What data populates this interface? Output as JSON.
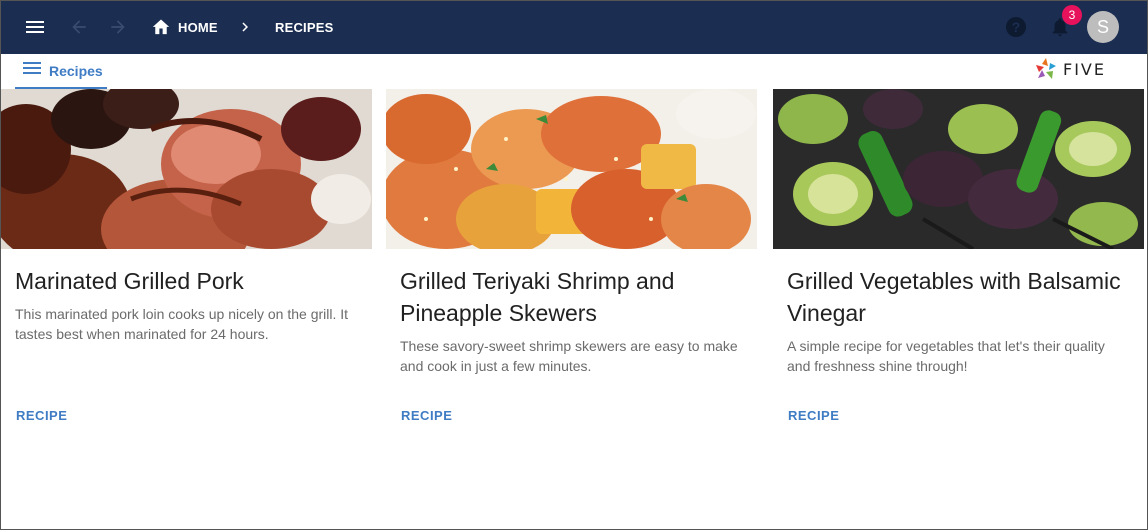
{
  "appbar": {
    "icons": {
      "menu": "menu-icon",
      "back": "arrow-back-icon",
      "forward": "arrow-forward-icon",
      "home": "home-icon",
      "separator": "chevron-right-icon",
      "help": "help-icon",
      "notifications": "bell-icon"
    },
    "breadcrumb": {
      "home": "HOME",
      "current": "RECIPES"
    },
    "notification_count": "3",
    "avatar_initial": "S",
    "colors": {
      "background": "#1b2e52",
      "badge": "#e8125c",
      "avatar": "#bdbdbd"
    }
  },
  "tabbar": {
    "active_tab": "Recipes",
    "logo_text": "FIVE",
    "accent": "#3f7cc4"
  },
  "cards": [
    {
      "title": "Marinated Grilled Pork",
      "description": "This marinated pork loin cooks up nicely on the grill. It tastes best when marinated for 24 hours.",
      "action": "RECIPE"
    },
    {
      "title": "Grilled Teriyaki Shrimp and Pineapple Skewers",
      "description": "These savory-sweet shrimp skewers are easy to make and cook in just a few minutes.",
      "action": "RECIPE"
    },
    {
      "title": "Grilled Vegetables with Balsamic Vinegar",
      "description": "A simple recipe for vegetables that let's their quality and freshness shine through!",
      "action": "RECIPE"
    }
  ]
}
